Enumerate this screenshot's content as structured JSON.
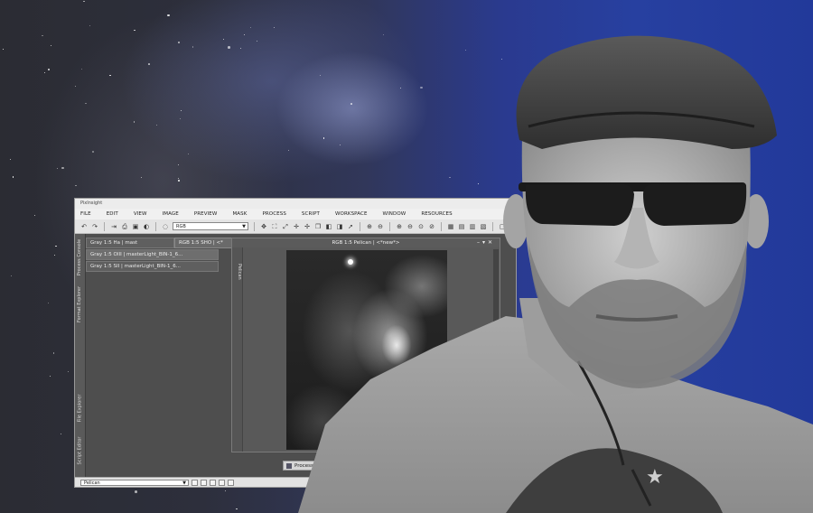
{
  "window": {
    "title": "PixInsight"
  },
  "menu": [
    "FILE",
    "EDIT",
    "VIEW",
    "IMAGE",
    "PREVIEW",
    "MASK",
    "PROCESS",
    "SCRIPT",
    "WORKSPACE",
    "WINDOW",
    "RESOURCES"
  ],
  "toolbar": {
    "color_mode": "RGB",
    "icons": [
      "undo-icon",
      "redo-icon",
      "new-icon",
      "open-icon",
      "save-icon",
      "close-icon",
      "refresh-icon"
    ]
  },
  "side_tabs": [
    "Process Console",
    "Format Explorer",
    "File Explorer",
    "Script Editor"
  ],
  "image_tabs": [
    "Gray 1:5 Ha | mast",
    "Gray 1:5 OIII | masterLight_BIN-1_6...",
    "Gray 1:5 SII | masterLight_BIN-1_6..."
  ],
  "second_tab": "RGB 1:5 SHO | <*",
  "image_window": {
    "title": "RGB 1:5 Pelican | <*new*>",
    "side_label": "Pelican"
  },
  "process_icon": "Process25",
  "status": {
    "view": "Pelican"
  },
  "colors": {
    "background_blue": "#2740a0",
    "app_bg": "#4b4b4b"
  }
}
